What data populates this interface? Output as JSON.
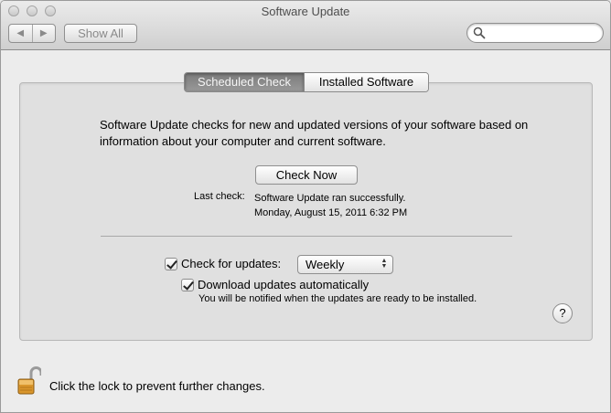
{
  "window": {
    "title": "Software Update"
  },
  "toolbar": {
    "back_icon": "back-arrow-icon",
    "forward_icon": "forward-arrow-icon",
    "back_glyph": "◀",
    "forward_glyph": "▶",
    "show_all_label": "Show All",
    "search_placeholder": ""
  },
  "tabs": [
    {
      "label": "Scheduled Check",
      "selected": true
    },
    {
      "label": "Installed Software",
      "selected": false
    }
  ],
  "main": {
    "description": "Software Update checks for new and updated versions of your software based on information about your computer and current software.",
    "check_now_label": "Check Now",
    "last_check_label": "Last check:",
    "last_check_status": "Software Update ran successfully.",
    "last_check_date": "Monday, August 15, 2011 6:32 PM",
    "check_for_updates": {
      "label": "Check for updates:",
      "checked": true
    },
    "frequency": {
      "selected": "Weekly"
    },
    "download_auto": {
      "label": "Download updates automatically",
      "checked": true
    },
    "download_note": "You will be notified when the updates are ready to be installed.",
    "help_label": "?"
  },
  "footer": {
    "lock_icon": "unlocked-padlock-icon",
    "lock_text": "Click the lock to prevent further changes."
  }
}
